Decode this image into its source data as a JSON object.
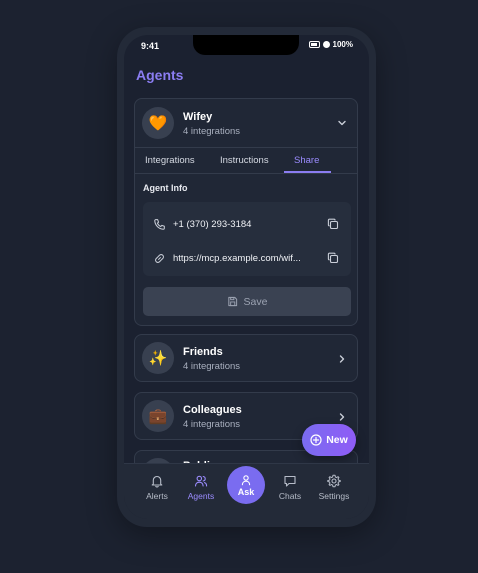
{
  "status_bar": {
    "time": "9:41",
    "battery": "100%"
  },
  "header": {
    "title": "Agents"
  },
  "agents": [
    {
      "name": "Wifey",
      "integrations": "4 integrations",
      "avatar": "🧡"
    },
    {
      "name": "Friends",
      "integrations": "4 integrations",
      "avatar": "✨"
    },
    {
      "name": "Colleagues",
      "integrations": "4 integrations",
      "avatar": "💼"
    },
    {
      "name": "Public",
      "integrations": "",
      "avatar": ""
    }
  ],
  "tabs": [
    "Integrations",
    "Instructions",
    "Share"
  ],
  "active_tab": "Share",
  "agent_info": {
    "label": "Agent Info",
    "phone": "+1 (370) 293-3184",
    "url": "https://mcp.example.com/wif..."
  },
  "save_label": "Save",
  "fab_label": "New",
  "nav": {
    "alerts": "Alerts",
    "agents": "Agents",
    "ask": "Ask",
    "chats": "Chats",
    "settings": "Settings"
  },
  "colors": {
    "accent": "#8b7df2",
    "background": "#1c2230",
    "card": "#202736"
  }
}
